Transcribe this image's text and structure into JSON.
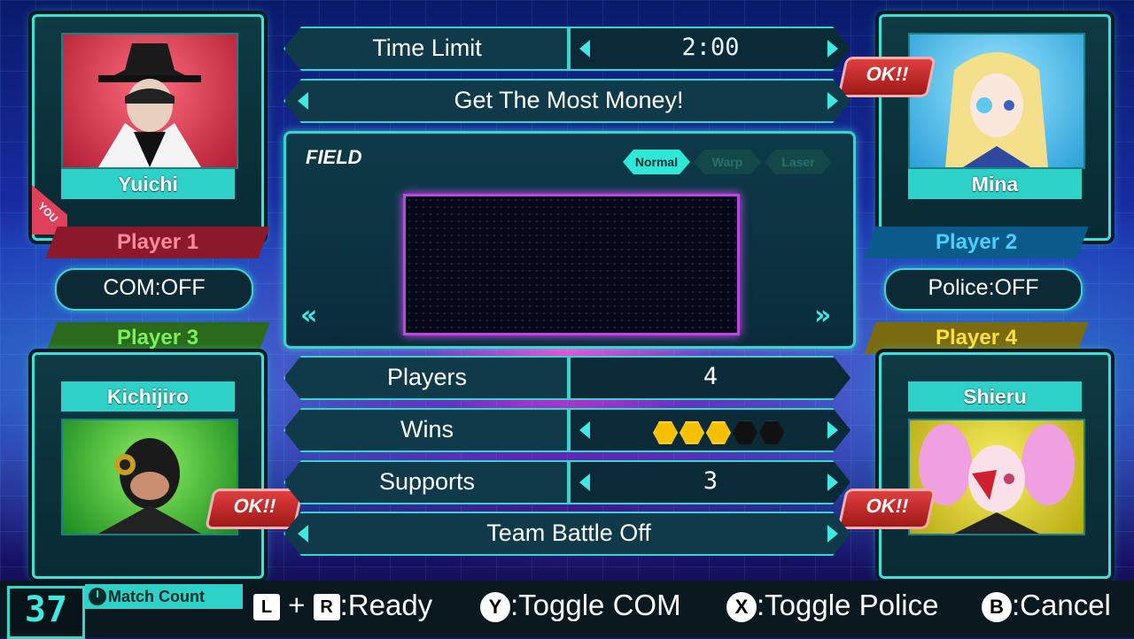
{
  "settings": {
    "time_limit_label": "Time Limit",
    "time_limit_value": "2:00",
    "mode": "Get The Most Money!",
    "field_title": "FIELD",
    "field_modes": [
      "Normal",
      "Warp",
      "Laser"
    ],
    "field_mode_selected": "Normal",
    "players_label": "Players",
    "players_value": "4",
    "wins_label": "Wins",
    "wins_value": 3,
    "wins_max": 5,
    "supports_label": "Supports",
    "supports_value": "3",
    "team_battle": "Team Battle Off"
  },
  "players": {
    "p1": {
      "name": "Yuichi",
      "tag": "Player 1",
      "you_badge": "YOU",
      "option": "COM:OFF",
      "color": "#e0405a",
      "portrait_bg": "#c0283c"
    },
    "p2": {
      "name": "Mina",
      "tag": "Player 2",
      "ready": "OK!!",
      "option": "Police:OFF",
      "color": "#2aa8e8",
      "portrait_bg": "#3ab8e8"
    },
    "p3": {
      "name": "Kichijiro",
      "tag": "Player 3",
      "ready": "OK!!",
      "color": "#5cd040",
      "portrait_bg": "#2aa030"
    },
    "p4": {
      "name": "Shieru",
      "tag": "Player 4",
      "ready": "OK!!",
      "color": "#e8c020",
      "portrait_bg": "#d8c820"
    }
  },
  "footer": {
    "match_count_value": "37",
    "match_count_label": "Match Count",
    "hints": [
      {
        "buttons": [
          "L",
          "R"
        ],
        "joiner": "+",
        "text": ":Ready"
      },
      {
        "buttons": [
          "Y"
        ],
        "text": ":Toggle COM"
      },
      {
        "buttons": [
          "X"
        ],
        "text": ":Toggle Police"
      },
      {
        "buttons": [
          "B"
        ],
        "text": ":Cancel"
      }
    ]
  }
}
